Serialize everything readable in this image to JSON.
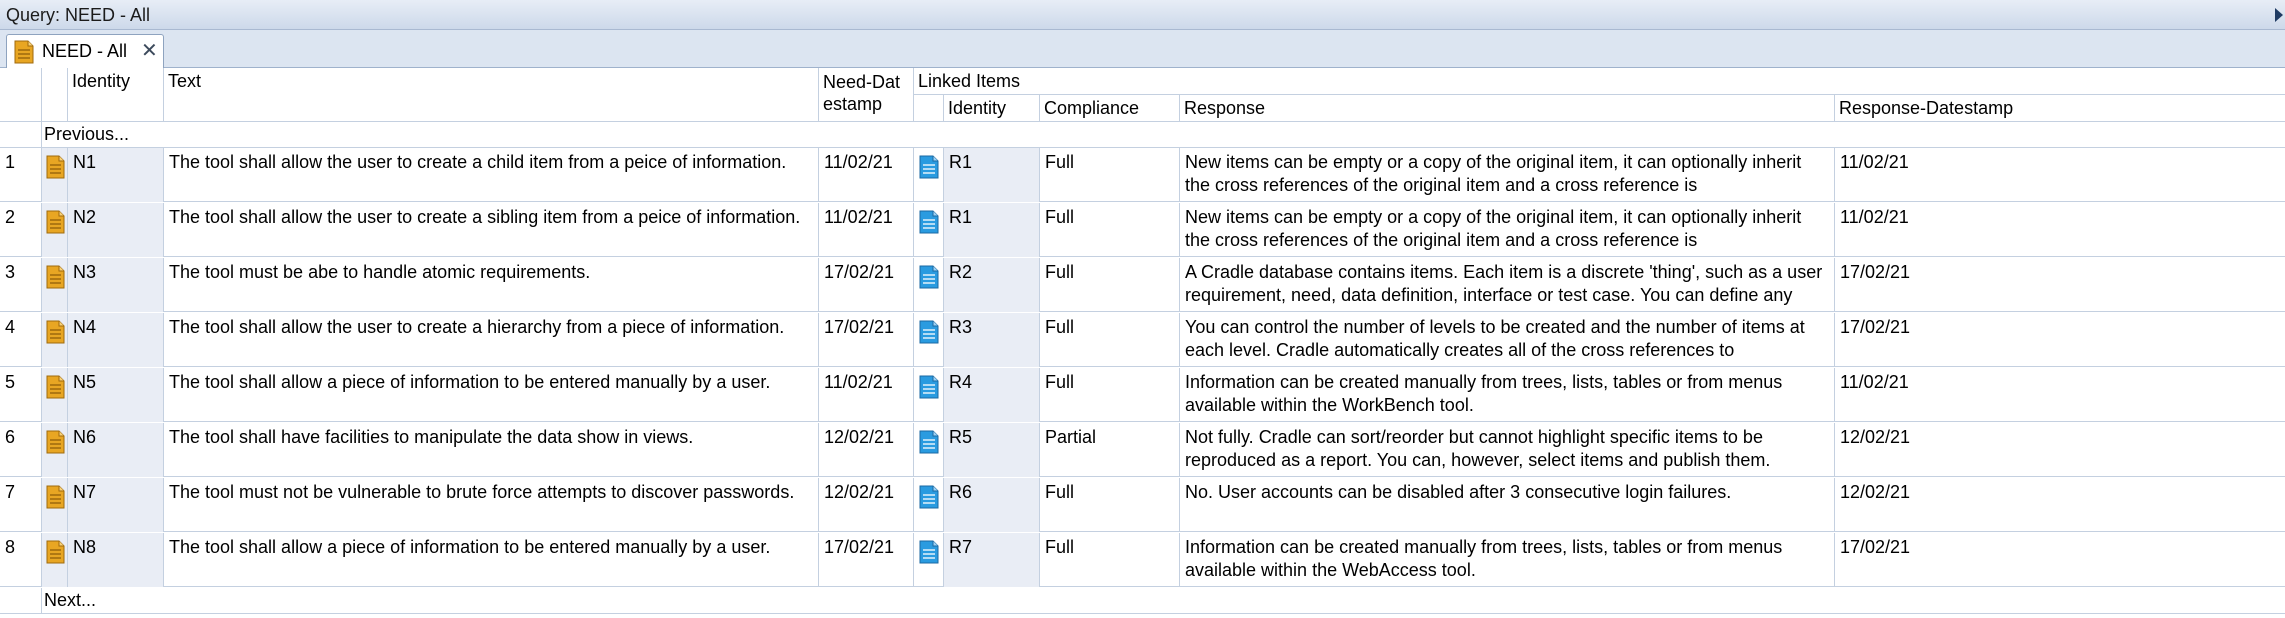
{
  "window": {
    "title": "Query: NEED - All"
  },
  "tab": {
    "label": "NEED - All",
    "close_glyph": "✕",
    "icon": "need-doc-icon"
  },
  "columns": {
    "identity": "Identity",
    "text": "Text",
    "need_datestamp": "Need-Datestamp",
    "linked_items": "Linked Items",
    "linked_identity": "Identity",
    "compliance": "Compliance",
    "response": "Response",
    "response_datestamp": "Response-Datestamp"
  },
  "nav": {
    "previous": "Previous...",
    "next": "Next..."
  },
  "rows": [
    {
      "num": "1",
      "id": "N1",
      "text": "The tool shall allow the user to create a child item from a peice of information.",
      "date": "11/02/21",
      "rid": "R1",
      "compliance": "Full",
      "response": "New items can be empty or a copy of the original item, it can optionally inherit the cross references of the original item and a cross reference is",
      "rdate": "11/02/21"
    },
    {
      "num": "2",
      "id": "N2",
      "text": "The tool shall allow the user to create a sibling item from a peice of information.",
      "date": "11/02/21",
      "rid": "R1",
      "compliance": "Full",
      "response": "New items can be empty or a copy of the original item, it can optionally inherit the cross references of the original item and a cross reference is",
      "rdate": "11/02/21"
    },
    {
      "num": "3",
      "id": "N3",
      "text": "The tool must be abe to handle atomic requirements.",
      "date": "17/02/21",
      "rid": "R2",
      "compliance": "Full",
      "response": "A Cradle database contains items. Each item is a discrete 'thing', such as a user requirement, need, data definition, interface or test case. You can define any",
      "rdate": "17/02/21"
    },
    {
      "num": "4",
      "id": "N4",
      "text": "The tool shall allow the user to create a hierarchy from a piece of information.",
      "date": "17/02/21",
      "rid": "R3",
      "compliance": "Full",
      "response": "You can control the number of levels to be created and the number of items at each level. Cradle automatically creates all of the cross references to",
      "rdate": "17/02/21"
    },
    {
      "num": "5",
      "id": "N5",
      "text": "The tool shall allow a piece of information to be entered manually by a user.",
      "date": "11/02/21",
      "rid": "R4",
      "compliance": "Full",
      "response": "Information can be created manually from trees, lists, tables or from menus available within the WorkBench tool.",
      "rdate": "11/02/21"
    },
    {
      "num": "6",
      "id": "N6",
      "text": "The tool shall have facilities to manipulate the data show in views.",
      "date": "12/02/21",
      "rid": "R5",
      "compliance": "Partial",
      "response": "Not fully. Cradle can sort/reorder but cannot highlight specific items to be reproduced as a report. You can, however, select items and publish them.",
      "rdate": "12/02/21"
    },
    {
      "num": "7",
      "id": "N7",
      "text": "The tool must not be vulnerable to brute force attempts to discover passwords.",
      "date": "12/02/21",
      "rid": "R6",
      "compliance": "Full",
      "response": "No. User accounts can be disabled after 3 consecutive login failures.",
      "rdate": "12/02/21"
    },
    {
      "num": "8",
      "id": "N8",
      "text": "The tool shall allow a piece of information to be entered manually by a user.",
      "date": "17/02/21",
      "rid": "R7",
      "compliance": "Full",
      "response": "Information can be created manually from trees, lists, tables or from menus available within the WebAccess tool.",
      "rdate": "17/02/21"
    }
  ],
  "colors": {
    "need_icon": "#e8a623",
    "response_icon": "#2a9be0",
    "shaded_cell": "#e9edf5",
    "grid_line": "#c4d0e0"
  }
}
